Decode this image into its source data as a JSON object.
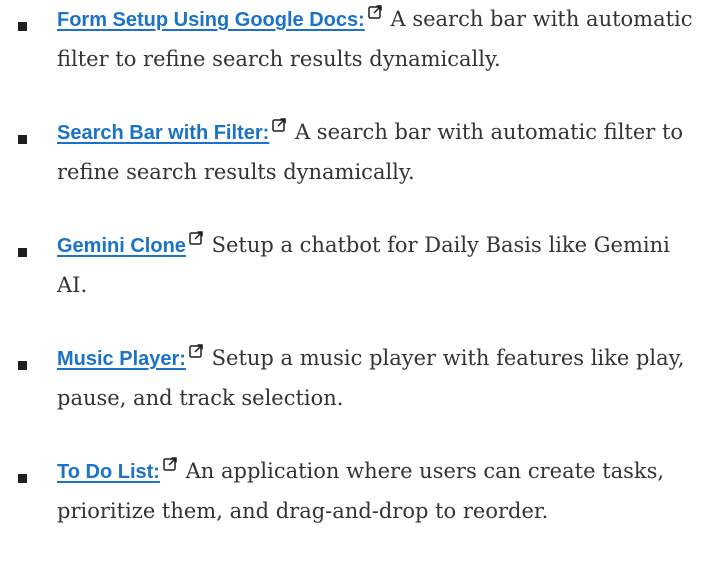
{
  "items": [
    {
      "link": "Form Setup Using Google Docs:",
      "description": " A search bar with automatic filter to refine search results dynamically."
    },
    {
      "link": "Search Bar with Filter:",
      "description": " A search bar with automatic filter to refine search results dynamically."
    },
    {
      "link": "Gemini Clone",
      "description": " Setup a chatbot for Daily Basis like Gemini AI."
    },
    {
      "link": "Music Player:",
      "description": " Setup a music player with features like play, pause, and track selection."
    },
    {
      "link": "To Do List:",
      "description": " An application where users can create tasks, prioritize them, and drag-and-drop to reorder."
    }
  ],
  "icons": {
    "bullet": "square-bullet-icon",
    "external": "external-link-icon"
  },
  "colors": {
    "link": "#1a73c8",
    "text": "#333333",
    "bullet": "#1f1f1f",
    "background": "#ffffff"
  }
}
